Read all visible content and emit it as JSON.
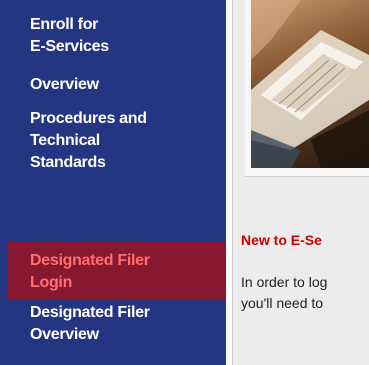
{
  "sidebar": {
    "items": [
      {
        "lines": [
          "Enroll for",
          "E-Services"
        ]
      },
      {
        "lines": [
          "Overview"
        ]
      },
      {
        "lines": [
          "Procedures and",
          "Technical",
          "Standards"
        ]
      },
      {
        "lines": [
          "Designated Filer",
          "Login"
        ],
        "active": true
      },
      {
        "lines": [
          "Designated Filer",
          "Overview"
        ]
      }
    ]
  },
  "main": {
    "heading": "New to E-Se",
    "body_lines": [
      "In order to log",
      "you'll need to"
    ]
  },
  "colors": {
    "sidebar_bg": "#243582",
    "active_bg": "#86182f",
    "active_text": "#ff6f6f",
    "heading_text": "#cc0000",
    "content_bg": "#ececec"
  }
}
